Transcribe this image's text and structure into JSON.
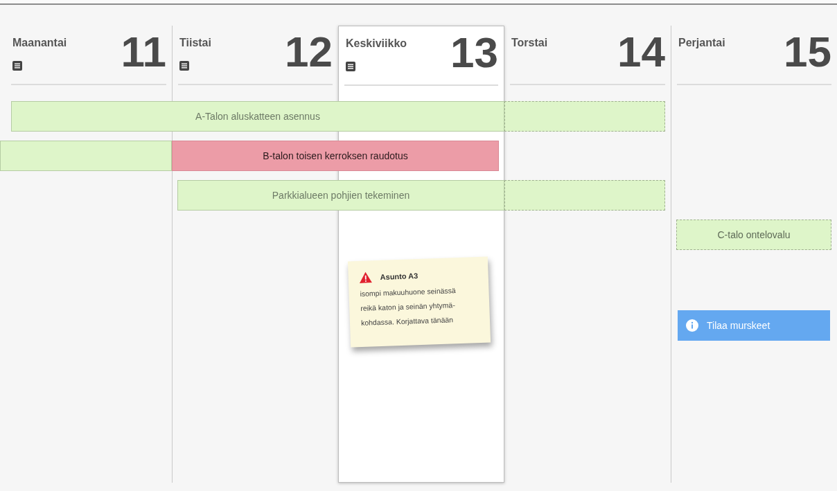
{
  "days": [
    {
      "name": "Maanantai",
      "date": "11",
      "has_notes": true,
      "selected": false
    },
    {
      "name": "Tiistai",
      "date": "12",
      "has_notes": true,
      "selected": false
    },
    {
      "name": "Keskiviikko",
      "date": "13",
      "has_notes": true,
      "selected": true,
      "notes": [
        {
          "kind": "warning",
          "title": "Asunto A3",
          "text": "isompi makuuhuone seinässä reikä katon ja seinän yhtymä-kohdassa. Korjattava tänään"
        }
      ]
    },
    {
      "name": "Torstai",
      "date": "14",
      "has_notes": false,
      "selected": false
    },
    {
      "name": "Perjantai",
      "date": "15",
      "has_notes": false,
      "selected": false,
      "notes": [
        {
          "kind": "info",
          "text": "Tilaa murskeet"
        }
      ]
    }
  ],
  "tasks": [
    {
      "title": "A-Talon aluskatteen asennus",
      "days": [
        {
          "kind": "done"
        },
        {
          "kind": "done"
        },
        {
          "kind": "done"
        },
        {
          "kind": "planned"
        },
        {
          "kind": "none"
        }
      ]
    },
    {
      "title": "B-talon toisen kerroksen raudotus",
      "days": [
        {
          "kind": "prior"
        },
        {
          "kind": "late"
        },
        {
          "kind": "late"
        },
        {
          "kind": "none"
        },
        {
          "kind": "none"
        }
      ]
    },
    {
      "title": "Parkkialueen pohjien tekeminen",
      "days": [
        {
          "kind": "none"
        },
        {
          "kind": "done"
        },
        {
          "kind": "done"
        },
        {
          "kind": "planned"
        },
        {
          "kind": "none"
        }
      ]
    },
    {
      "title": "C-talo ontelovalu",
      "days": [
        {
          "kind": "none"
        },
        {
          "kind": "none"
        },
        {
          "kind": "none"
        },
        {
          "kind": "none"
        },
        {
          "kind": "planned"
        }
      ]
    }
  ]
}
